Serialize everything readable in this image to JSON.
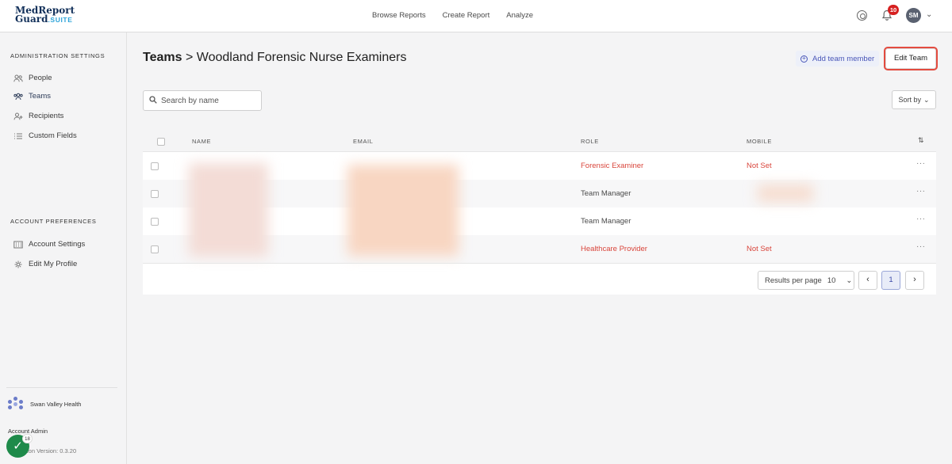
{
  "brand": {
    "line1": "MedReport",
    "line2": "Guard",
    "suite": ".SUITE"
  },
  "topnav": [
    "Browse Reports",
    "Create Report",
    "Analyze"
  ],
  "header": {
    "notifications": "10",
    "avatar_initials": "SM"
  },
  "sidebar": {
    "admin_heading": "ADMINISTRATION SETTINGS",
    "admin_items": [
      {
        "label": "People",
        "icon": "people-icon"
      },
      {
        "label": "Teams",
        "icon": "teams-icon"
      },
      {
        "label": "Recipients",
        "icon": "add-person-icon"
      },
      {
        "label": "Custom Fields",
        "icon": "list-icon"
      }
    ],
    "account_heading": "ACCOUNT PREFERENCES",
    "account_items": [
      {
        "label": "Account Settings",
        "icon": "building-icon"
      },
      {
        "label": "Edit My Profile",
        "icon": "gear-icon"
      }
    ],
    "org_name": "Swan Valley Health",
    "role": "Account Admin",
    "version": "ion Version: 0.3.20",
    "fab_count": "18"
  },
  "page": {
    "crumb_root": "Teams",
    "separator": ">",
    "team_name": "Woodland Forensic Nurse Examiners",
    "add_member_label": "Add team member",
    "edit_team_label": "Edit Team"
  },
  "search": {
    "placeholder": "Search by name"
  },
  "sort": {
    "label": "Sort by"
  },
  "table": {
    "columns": [
      "NAME",
      "EMAIL",
      "ROLE",
      "MOBILE"
    ],
    "rows": [
      {
        "role": "Forensic Examiner",
        "mobile": "Not Set"
      },
      {
        "role": "Team Manager",
        "mobile": ""
      },
      {
        "role": "Team Manager",
        "mobile": ""
      },
      {
        "role": "Healthcare Provider",
        "mobile": "Not Set"
      }
    ]
  },
  "pagination": {
    "rpp_label": "Results per page",
    "rpp_value": "10",
    "current_page": "1"
  },
  "colors": {
    "accent": "#4956b8",
    "danger": "#d9453b",
    "highlight": "#e34b3f",
    "brand_navy": "#12305a"
  }
}
